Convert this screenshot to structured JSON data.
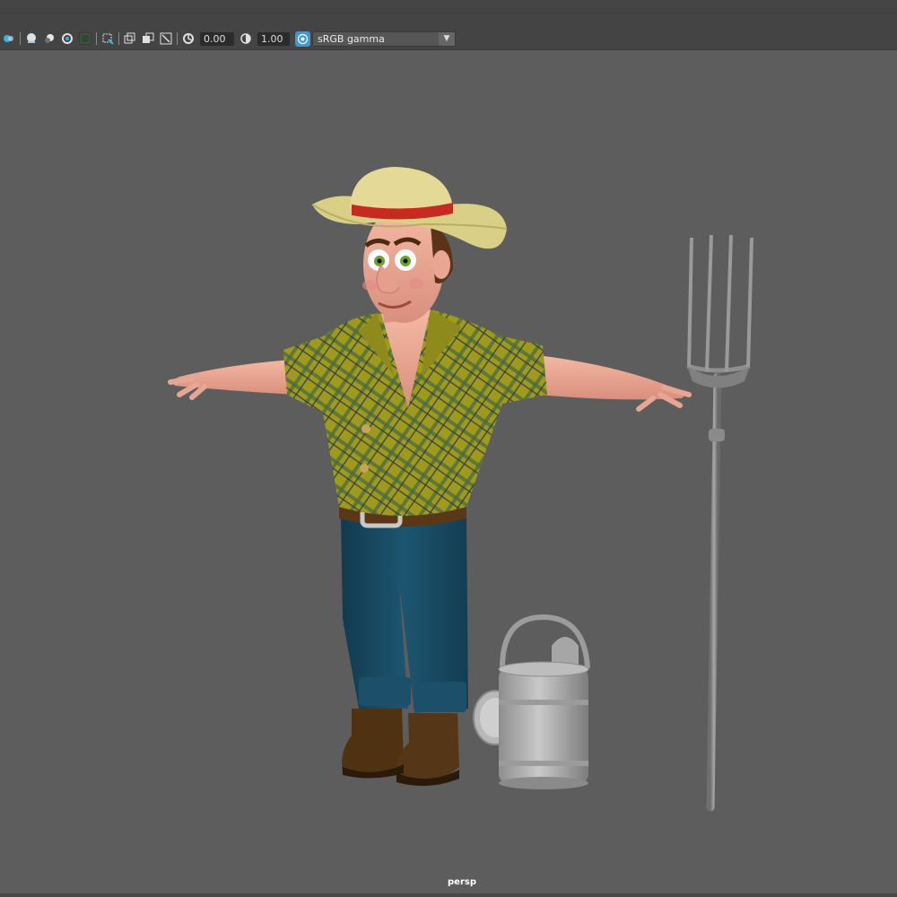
{
  "toolbar": {
    "exposure_value": "0.00",
    "gamma_value": "1.00",
    "color_space": "sRGB gamma",
    "icons": [
      "shading-icon",
      "lighting-icon",
      "shadow-icon",
      "isolate-icon",
      "grid-icon",
      "select-icon",
      "resolution-gate-icon",
      "film-gate-icon",
      "safe-action-icon",
      "exposure-icon",
      "gamma-icon",
      "color-management-icon"
    ]
  },
  "viewport": {
    "camera_name": "persp",
    "objects": [
      "farmer-character",
      "pitchfork",
      "watering-can"
    ]
  },
  "colors": {
    "toolbar_bg": "#444444",
    "viewport_bg": "#5d5d5d",
    "accent": "#3b9ad8"
  }
}
